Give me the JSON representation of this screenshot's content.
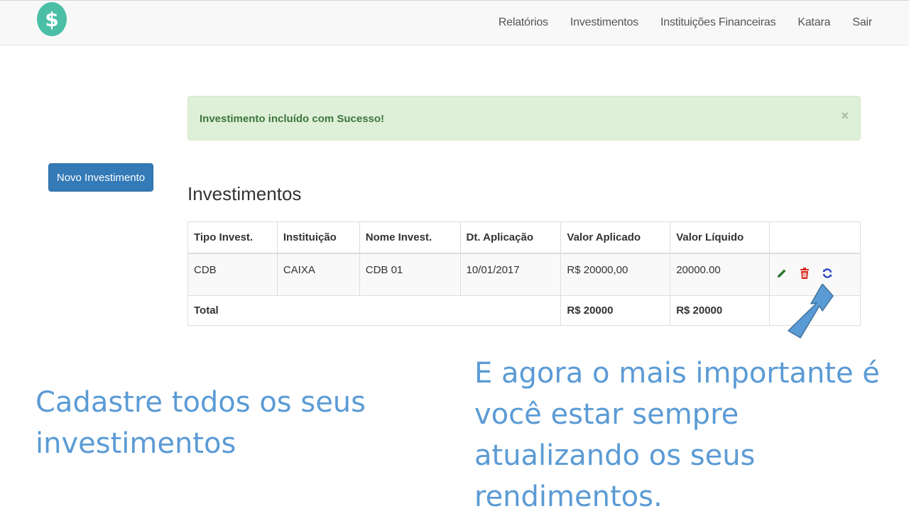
{
  "navbar": {
    "logo_symbol": "$",
    "links": [
      "Relatórios",
      "Investimentos",
      "Instituições Financeiras",
      "Katara",
      "Sair"
    ]
  },
  "alert": {
    "message": "Investimento incluído com Sucesso!",
    "close_symbol": "×"
  },
  "new_button_label": "Novo Investimento",
  "section_title": "Investimentos",
  "table": {
    "headers": [
      "Tipo Invest.",
      "Instituição",
      "Nome Invest.",
      "Dt. Aplicação",
      "Valor Aplicado",
      "Valor Líquido"
    ],
    "rows": [
      {
        "tipo": "CDB",
        "instituicao": "CAIXA",
        "nome": "CDB 01",
        "data": "10/01/2017",
        "valor_aplicado": "R$ 20000,00",
        "valor_liquido": "20000.00"
      }
    ],
    "total": {
      "label": "Total",
      "valor_aplicado": "R$ 20000",
      "valor_liquido": "R$ 20000"
    },
    "row_action_icons": [
      "pencil-icon",
      "trash-icon",
      "refresh-icon"
    ]
  },
  "captions": {
    "left": "Cadastre todos os seus investimentos",
    "right": "E agora o mais importante é você estar sempre atualizando os seus rendimentos."
  },
  "colors": {
    "logo": "#4bbfa6",
    "primary": "#337ab7",
    "alert_bg": "#dff0d8",
    "alert_text": "#3c763d",
    "caption": "#5b9bd5",
    "edit": "#2e7d32",
    "delete": "#d9241c",
    "refresh": "#1f3fbf"
  }
}
